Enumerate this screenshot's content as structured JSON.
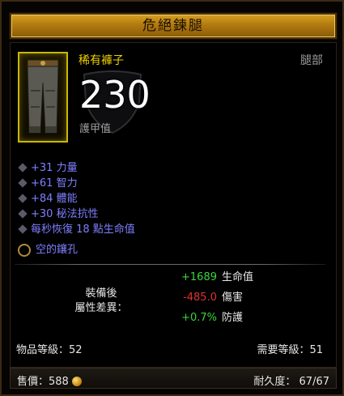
{
  "item": {
    "name": "危絕鍊腿",
    "type": "稀有褲子",
    "slot": "腿部",
    "armor_value": "230",
    "armor_label": "護甲值",
    "icon": "pants-icon"
  },
  "affixes": [
    "+31 力量",
    "+61 智力",
    "+84 體能",
    "+30 秘法抗性",
    "每秒恢復 18 點生命值"
  ],
  "socket": {
    "label": "空的鑲孔"
  },
  "compare": {
    "label_line1": "裝備後",
    "label_line2": "屬性差異：",
    "stats": [
      {
        "value": "+1689",
        "name": "生命值",
        "color": "#3ad53a"
      },
      {
        "value": "-485.0",
        "name": "傷害",
        "color": "#e03030"
      },
      {
        "value": "+0.7%",
        "name": "防護",
        "color": "#3ad53a"
      }
    ]
  },
  "item_level": "物品等級：52",
  "required_level": "需要等級：51",
  "price": {
    "label": "售價：588"
  },
  "durability": "耐久度： 67/67",
  "colors": {
    "title_gold": "#d7a020",
    "rare_yellow": "#f0d200",
    "affix_blue": "#7f7fff",
    "positive_green": "#3ad53a",
    "negative_red": "#e03030"
  }
}
